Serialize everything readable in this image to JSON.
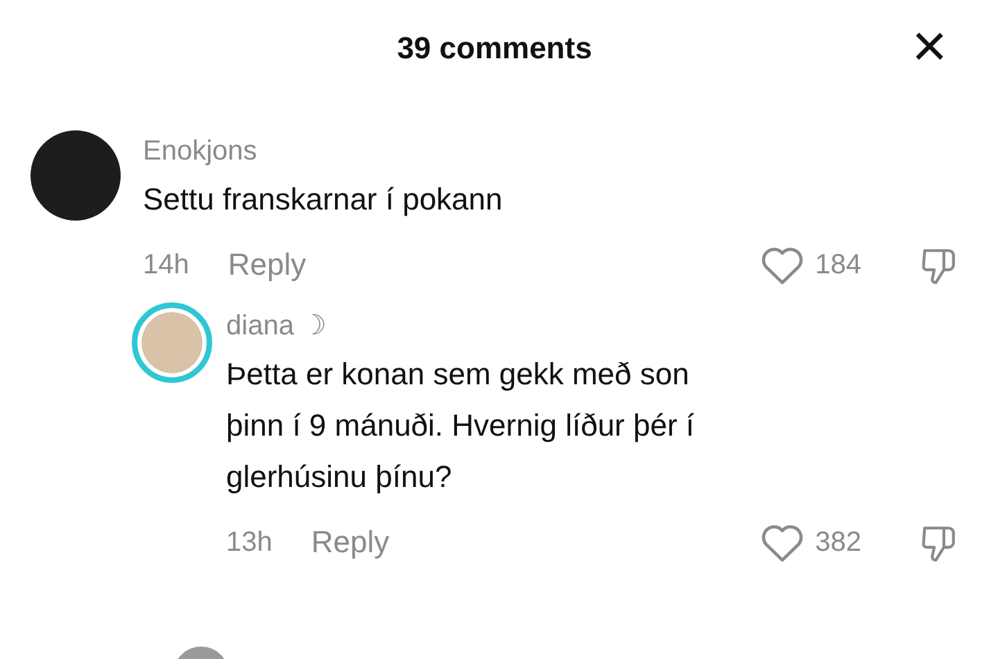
{
  "header": {
    "title": "39 comments",
    "close": "×"
  },
  "comments": [
    {
      "author": "Enokjons",
      "text": "Settu franskarnar í pokann",
      "time": "14h",
      "reply": "Reply",
      "likes": "184",
      "has_story": false,
      "children": [
        {
          "author": "diana ☽",
          "text": "Þetta er konan sem gekk með son þinn í 9 mánuði. Hvernig líður þér í glerhúsinu þínu?",
          "time": "13h",
          "reply": "Reply",
          "likes": "382",
          "has_story": true
        }
      ]
    }
  ]
}
